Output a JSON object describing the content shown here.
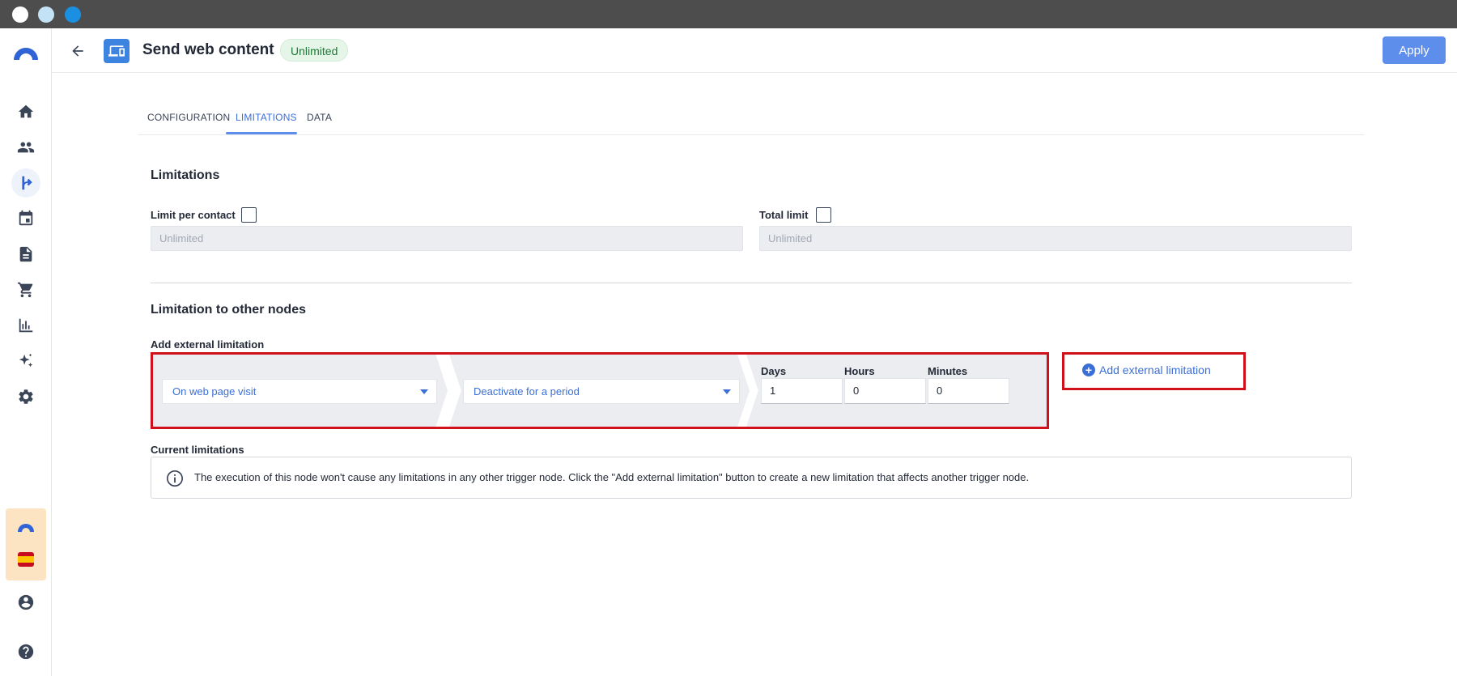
{
  "header": {
    "title": "Send web content",
    "status_badge": "Unlimited",
    "apply_label": "Apply"
  },
  "tabs": [
    {
      "label": "CONFIGURATION",
      "active": false
    },
    {
      "label": "LIMITATIONS",
      "active": true
    },
    {
      "label": "DATA",
      "active": false
    }
  ],
  "limitations": {
    "section_title": "Limitations",
    "per_contact": {
      "label": "Limit per contact",
      "checked": false,
      "value": "Unlimited"
    },
    "total": {
      "label": "Total limit",
      "checked": false,
      "value": "Unlimited"
    }
  },
  "other_nodes": {
    "section_title": "Limitation to other nodes",
    "add_label": "Add external limitation",
    "trigger_select": "On web page visit",
    "action_select": "Deactivate for a period",
    "days": {
      "label": "Days",
      "value": "1"
    },
    "hours": {
      "label": "Hours",
      "value": "0"
    },
    "minutes": {
      "label": "Minutes",
      "value": "0"
    },
    "add_button": "Add external limitation",
    "current_label": "Current limitations",
    "info_text": "The execution of this node won't cause any limitations in any other trigger node. Click the \"Add external limitation\" button to create a new limitation that affects another trigger node."
  },
  "sidebar": {
    "active_item": "journeys",
    "items": [
      "home-icon",
      "contacts-icon",
      "journeys-icon",
      "calendar-icon",
      "document-icon",
      "cart-icon",
      "analytics-icon",
      "ai-sparkle-icon",
      "settings-icon",
      "account-icon",
      "help-icon"
    ]
  },
  "colors": {
    "accent": "#5e8eeb",
    "link": "#3c6fd6",
    "badge_bg": "#e5f5e8",
    "highlight_border": "#d0101b"
  }
}
